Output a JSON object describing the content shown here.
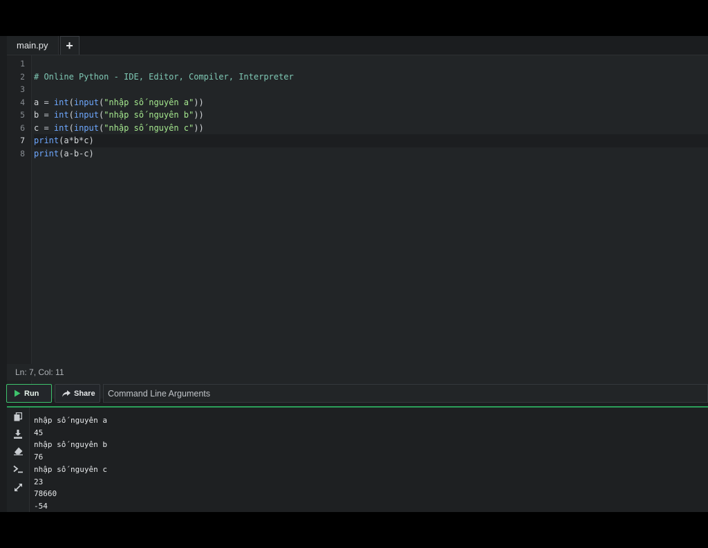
{
  "tabs": [
    {
      "label": "main.py"
    },
    {
      "label": "+"
    }
  ],
  "editor": {
    "line_numbers": [
      "1",
      "2",
      "3",
      "4",
      "5",
      "6",
      "7",
      "8"
    ],
    "active_line": 7,
    "lines": [
      [],
      [
        {
          "t": "comment",
          "v": "# Online Python - IDE, Editor, Compiler, Interpreter"
        }
      ],
      [],
      [
        {
          "t": "plain",
          "v": "a "
        },
        {
          "t": "op",
          "v": "="
        },
        {
          "t": "plain",
          "v": " "
        },
        {
          "t": "builtin",
          "v": "int"
        },
        {
          "t": "plain",
          "v": "("
        },
        {
          "t": "builtin",
          "v": "input"
        },
        {
          "t": "plain",
          "v": "("
        },
        {
          "t": "string",
          "v": "\"nhập số nguyên a\""
        },
        {
          "t": "plain",
          "v": "))"
        }
      ],
      [
        {
          "t": "plain",
          "v": "b "
        },
        {
          "t": "op",
          "v": "="
        },
        {
          "t": "plain",
          "v": " "
        },
        {
          "t": "builtin",
          "v": "int"
        },
        {
          "t": "plain",
          "v": "("
        },
        {
          "t": "builtin",
          "v": "input"
        },
        {
          "t": "plain",
          "v": "("
        },
        {
          "t": "string",
          "v": "\"nhập số nguyên b\""
        },
        {
          "t": "plain",
          "v": "))"
        }
      ],
      [
        {
          "t": "plain",
          "v": "c "
        },
        {
          "t": "op",
          "v": "="
        },
        {
          "t": "plain",
          "v": " "
        },
        {
          "t": "builtin",
          "v": "int"
        },
        {
          "t": "plain",
          "v": "("
        },
        {
          "t": "builtin",
          "v": "input"
        },
        {
          "t": "plain",
          "v": "("
        },
        {
          "t": "string",
          "v": "\"nhập số nguyên c\""
        },
        {
          "t": "plain",
          "v": "))"
        }
      ],
      [
        {
          "t": "builtin",
          "v": "print"
        },
        {
          "t": "plain",
          "v": "(a"
        },
        {
          "t": "op",
          "v": "*"
        },
        {
          "t": "plain",
          "v": "b"
        },
        {
          "t": "op",
          "v": "*"
        },
        {
          "t": "plain",
          "v": "c)"
        }
      ],
      [
        {
          "t": "builtin",
          "v": "print"
        },
        {
          "t": "plain",
          "v": "(a"
        },
        {
          "t": "op",
          "v": "-"
        },
        {
          "t": "plain",
          "v": "b"
        },
        {
          "t": "op",
          "v": "-"
        },
        {
          "t": "plain",
          "v": "c)"
        }
      ]
    ]
  },
  "status": {
    "text": "Ln: 7,  Col: 11"
  },
  "toolbar": {
    "run_label": "Run",
    "share_label": "Share",
    "cmd_placeholder": "Command Line Arguments"
  },
  "output": {
    "side_icons": [
      "copy-icon",
      "download-icon",
      "eraser-icon",
      "terminal-icon",
      "expand-icon"
    ],
    "lines": [
      "nhập số nguyên a",
      "45",
      "nhập số nguyên b",
      "76",
      "nhập số nguyên c",
      "23",
      "78660",
      "-54"
    ]
  },
  "colors": {
    "accent": "#3ec46d",
    "editor_bg": "#222527",
    "string": "#a5e88e",
    "builtin": "#6ea8ff",
    "comment": "#7fc8b4"
  }
}
